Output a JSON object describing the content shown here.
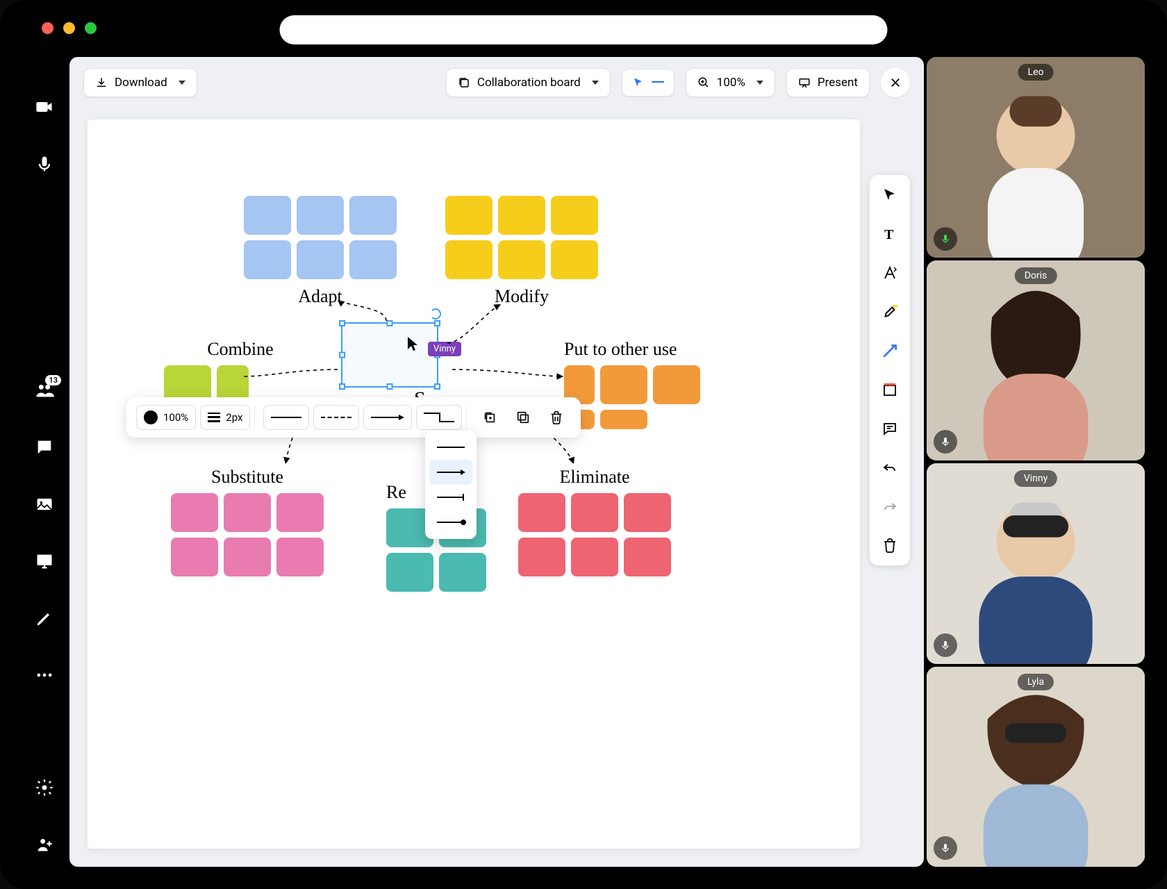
{
  "window": {
    "traffic": [
      "close",
      "minimize",
      "maximize"
    ]
  },
  "leftRail": {
    "participants_badge": "13"
  },
  "topbar": {
    "download": "Download",
    "board_name": "Collaboration board",
    "zoom": "100%",
    "present": "Present"
  },
  "canvas": {
    "clusters": {
      "adapt": "Adapt",
      "modify": "Modify",
      "combine": "Combine",
      "put_other": "Put to other use",
      "substitute": "Substitute",
      "eliminate": "Eliminate",
      "reverse": "Re",
      "center": "S"
    },
    "collaborator_tag": "Vinny",
    "colors": {
      "blue": "#a5c5f2",
      "yellow": "#f6cd1b",
      "lime": "#b8d638",
      "orange": "#f29a3a",
      "pink": "#ea7bb1",
      "teal": "#4bbab0",
      "coral": "#ef6472"
    }
  },
  "formatBar": {
    "opacity": "100%",
    "stroke_width": "2px"
  },
  "participants": [
    {
      "name": "Leo",
      "mic_active": true
    },
    {
      "name": "Doris",
      "mic_active": false
    },
    {
      "name": "Vinny",
      "mic_active": false
    },
    {
      "name": "Lyla",
      "mic_active": false
    }
  ]
}
